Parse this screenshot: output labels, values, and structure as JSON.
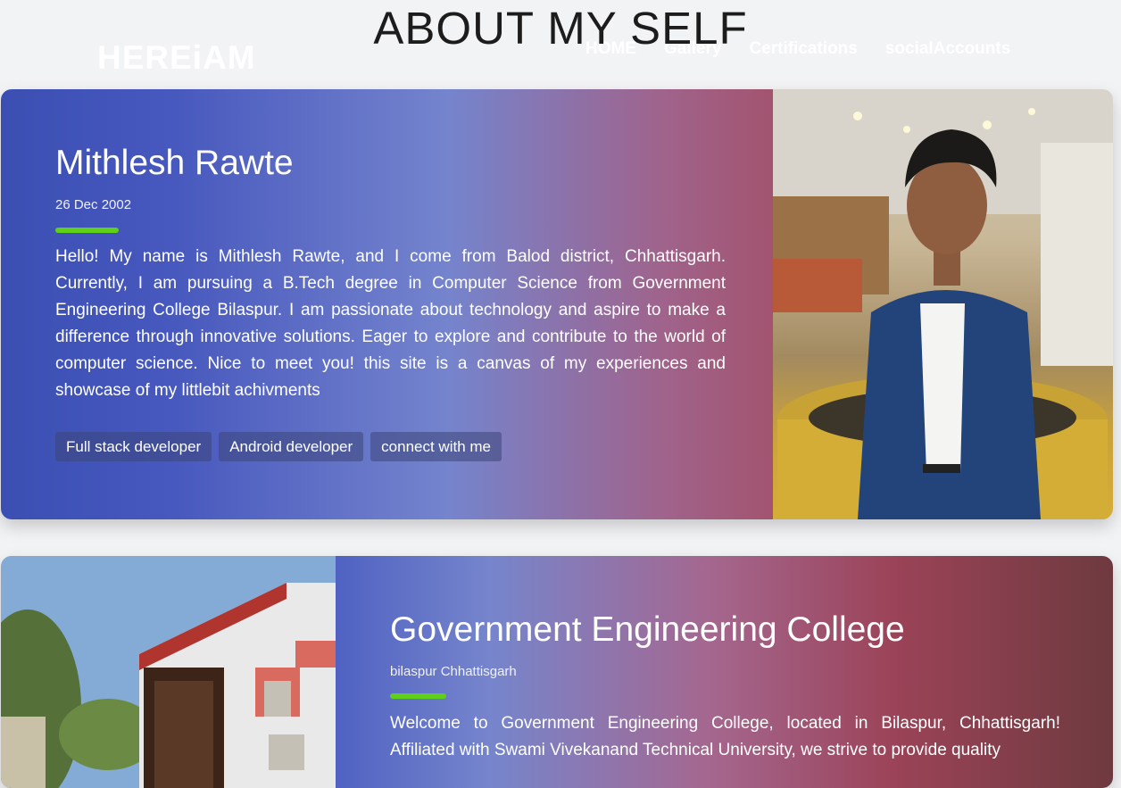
{
  "page": {
    "heading": "ABOUT MY SELF"
  },
  "navbar": {
    "brand": "HEREiAM",
    "links": [
      "HOME",
      "Gallery",
      "Certifications",
      "socialAccounts"
    ]
  },
  "about_card": {
    "name": "Mithlesh Rawte",
    "date": "26 Dec 2002",
    "bio": "Hello! My name is Mithlesh Rawte, and I come from Balod district, Chhattisgarh. Currently, I am pursuing a B.Tech degree in Computer Science from Government Engineering College Bilaspur. I am passionate about technology and aspire to make a difference through innovative solutions. Eager to explore and contribute to the world of computer science. Nice to meet you! this site is a canvas of my experiences and showcase of my littlebit achivments",
    "tags": [
      "Full stack developer",
      "Android developer",
      "connect with me"
    ]
  },
  "college_card": {
    "title": "Government Engineering College",
    "location": "bilaspur Chhattisgarh",
    "body": "Welcome to Government Engineering College, located in Bilaspur, Chhattisgarh! Affiliated with Swami Vivekanand Technical University, we strive to provide quality"
  },
  "colors": {
    "accent_bar": "#5ed017",
    "card1_gradient_start": "#3b4fb3",
    "card1_gradient_end": "#a2546f",
    "card2_gradient_end": "#6e3a3f"
  }
}
